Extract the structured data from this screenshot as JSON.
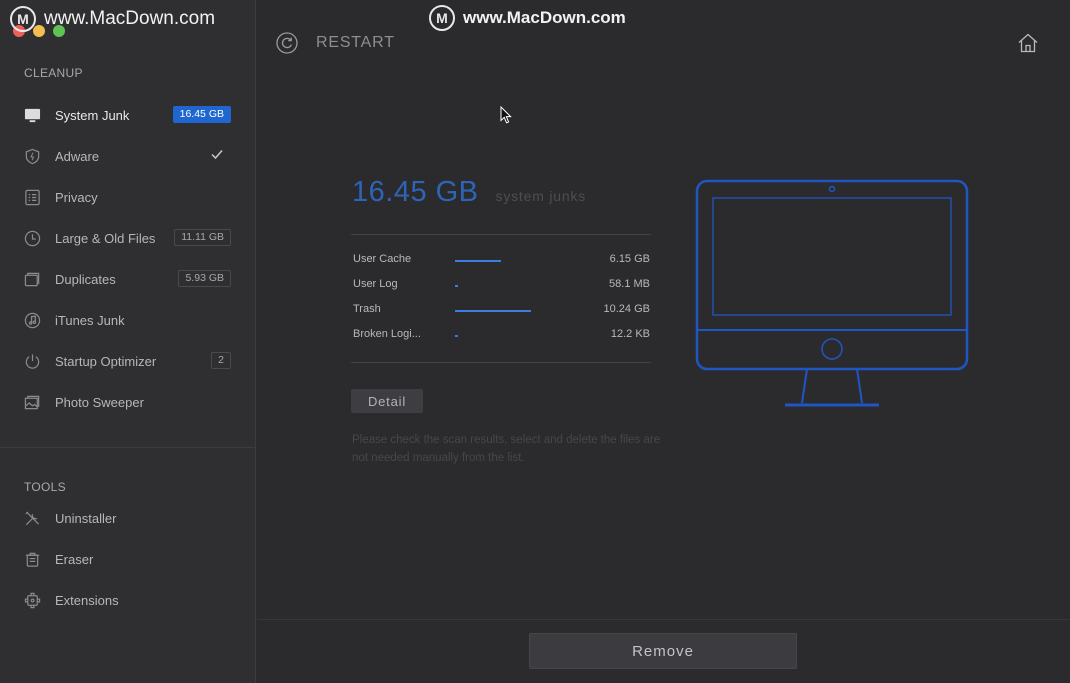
{
  "watermark": {
    "logo": "M",
    "text": "www.MacDown.com"
  },
  "sidebar": {
    "cleanup_title": "CLEANUP",
    "tools_title": "TOOLS",
    "cleanup_items": [
      {
        "label": "System Junk",
        "badge": "16.45 GB",
        "icon": "monitor-icon"
      },
      {
        "label": "Adware",
        "icon": "shield-icon"
      },
      {
        "label": "Privacy",
        "icon": "list-icon"
      },
      {
        "label": "Large & Old Files",
        "badge": "11.11 GB",
        "icon": "clock-icon"
      },
      {
        "label": "Duplicates",
        "badge": "5.93 GB",
        "icon": "folder-icon"
      },
      {
        "label": "iTunes Junk",
        "icon": "music-icon"
      },
      {
        "label": "Startup Optimizer",
        "badge": "2",
        "icon": "power-icon"
      },
      {
        "label": "Photo Sweeper",
        "icon": "photos-icon"
      }
    ],
    "tool_items": [
      {
        "label": "Uninstaller",
        "icon": "tools-icon"
      },
      {
        "label": "Eraser",
        "icon": "trash-icon"
      },
      {
        "label": "Extensions",
        "icon": "puzzle-icon"
      }
    ]
  },
  "header": {
    "restart_label": "RESTART"
  },
  "summary": {
    "size": "16.45 GB",
    "unit": "system junks"
  },
  "breakdown": [
    {
      "label": "User Cache",
      "size": "6.15 GB",
      "fraction": 0.6
    },
    {
      "label": "User Log",
      "size": "58.1 MB",
      "fraction": 0.04
    },
    {
      "label": "Trash",
      "size": "10.24 GB",
      "fraction": 1.0
    },
    {
      "label": "Broken Logi...",
      "size": "12.2 KB",
      "fraction": 0.04
    }
  ],
  "detail_label": "Detail",
  "note": "Please check the scan results, select and delete the files are not needed manually from the list.",
  "remove_label": "Remove",
  "colors": {
    "accent": "#2e64b8",
    "badge": "#1f66d1",
    "bar": "#3b7ee0"
  }
}
